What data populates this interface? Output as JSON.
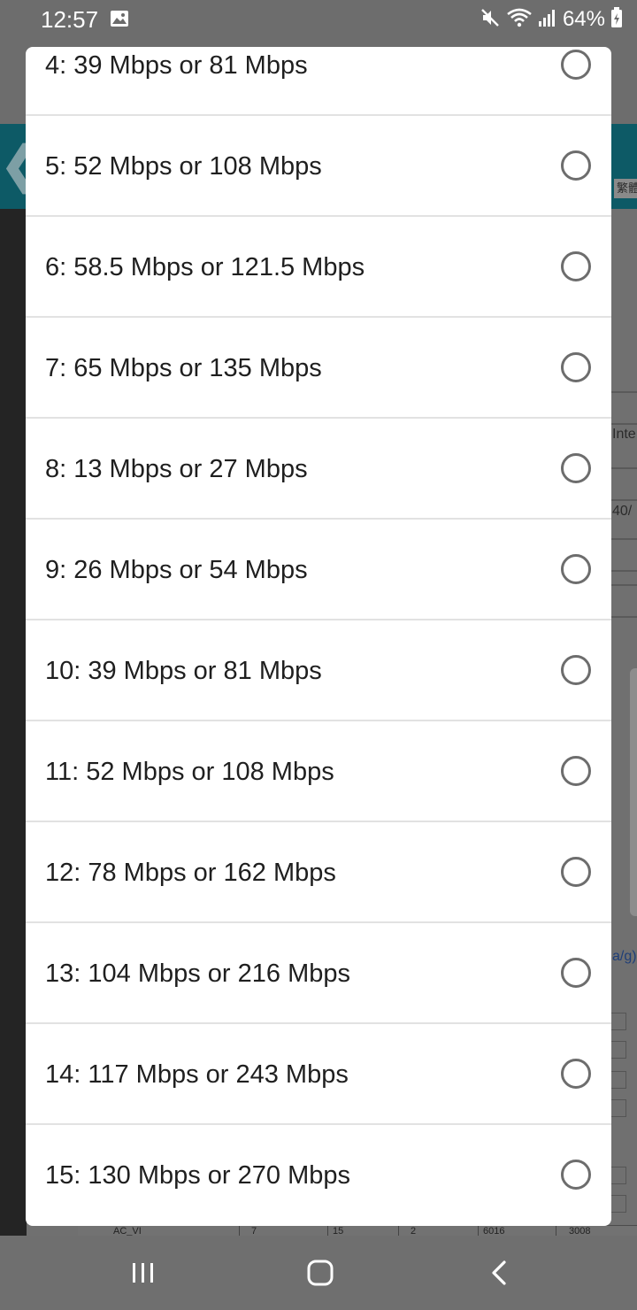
{
  "status_bar": {
    "time": "12:57",
    "battery_percent": "64%",
    "icons": [
      "gallery-icon",
      "mute-icon",
      "wifi-icon",
      "signal-icon",
      "battery-icon"
    ]
  },
  "background": {
    "lang_button": "繁體",
    "side_texts": [
      "Inte",
      "40/",
      "a/g)"
    ],
    "table_strip": [
      "AC_VI",
      "7",
      "15",
      "2",
      "6016",
      "3008"
    ]
  },
  "dialog": {
    "options": [
      {
        "label": "4: 39 Mbps or 81 Mbps",
        "selected": false
      },
      {
        "label": "5: 52 Mbps or 108 Mbps",
        "selected": false
      },
      {
        "label": "6: 58.5 Mbps or 121.5 Mbps",
        "selected": false
      },
      {
        "label": "7: 65 Mbps or 135 Mbps",
        "selected": false
      },
      {
        "label": "8: 13 Mbps or 27 Mbps",
        "selected": false
      },
      {
        "label": "9: 26 Mbps or 54 Mbps",
        "selected": false
      },
      {
        "label": "10: 39 Mbps or 81 Mbps",
        "selected": false
      },
      {
        "label": "11: 52 Mbps or 108 Mbps",
        "selected": false
      },
      {
        "label": "12: 78 Mbps or 162 Mbps",
        "selected": false
      },
      {
        "label": "13: 104 Mbps or 216 Mbps",
        "selected": false
      },
      {
        "label": "14: 117 Mbps or 243 Mbps",
        "selected": false
      },
      {
        "label": "15: 130 Mbps or 270 Mbps",
        "selected": false
      }
    ]
  },
  "nav_bar": {
    "buttons": [
      "recent-apps-icon",
      "home-icon",
      "back-icon"
    ]
  },
  "colors": {
    "dialog_bg": "#ffffff",
    "divider": "#e2e2e2",
    "radio_border": "#6d6d6d",
    "scrim": "#6b6b6b",
    "header_teal": "#0d5a66"
  }
}
